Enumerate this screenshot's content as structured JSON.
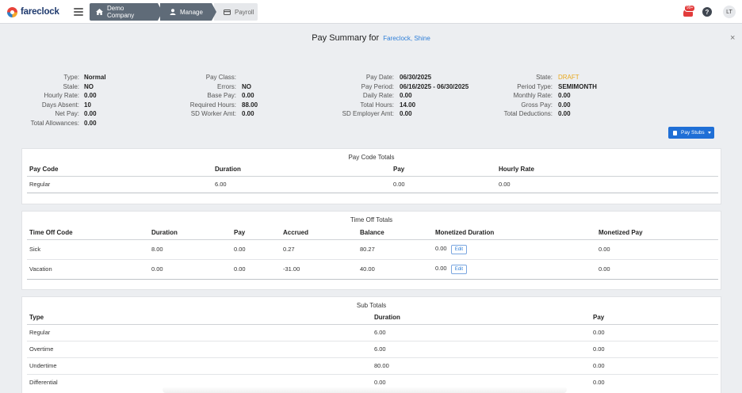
{
  "app": {
    "logo_text": "fareclock"
  },
  "breadcrumbs": [
    {
      "label": "Demo Company",
      "icon": "home-icon"
    },
    {
      "label": "Manage",
      "icon": "user-icon"
    },
    {
      "label": "Payroll",
      "icon": "card-icon"
    }
  ],
  "header_right": {
    "notification_badge": "99+",
    "help_label": "?",
    "avatar_initials": "LT"
  },
  "page": {
    "title": "Pay Summary for",
    "employee": "Fareclock, Shine",
    "close_label": "×"
  },
  "summary": {
    "col1": [
      {
        "label": "Type:",
        "value": "Normal"
      },
      {
        "label": "Stale:",
        "value": "NO"
      },
      {
        "label": "Hourly Rate:",
        "value": "0.00"
      },
      {
        "label": "Days Absent:",
        "value": "10"
      },
      {
        "label": "Net Pay:",
        "value": "0.00"
      },
      {
        "label": "Total Allowances:",
        "value": "0.00"
      }
    ],
    "col2": [
      {
        "label": "Pay Class:",
        "value": ""
      },
      {
        "label": "Errors:",
        "value": "NO"
      },
      {
        "label": "Base Pay:",
        "value": "0.00"
      },
      {
        "label": "Required Hours:",
        "value": "88.00"
      },
      {
        "label": "SD Worker Amt:",
        "value": "0.00"
      }
    ],
    "col3": [
      {
        "label": "Pay Date:",
        "value": "06/30/2025"
      },
      {
        "label": "Pay Period:",
        "value": "06/16/2025 - 06/30/2025"
      },
      {
        "label": "Daily Rate:",
        "value": "0.00"
      },
      {
        "label": "Total Hours:",
        "value": "14.00"
      },
      {
        "label": "SD Employer Amt:",
        "value": "0.00"
      }
    ],
    "col4": [
      {
        "label": "State:",
        "value": "DRAFT"
      },
      {
        "label": "Period Type:",
        "value": "SEMIMONTH"
      },
      {
        "label": "Monthly Rate:",
        "value": "0.00"
      },
      {
        "label": "Gross Pay:",
        "value": "0.00"
      },
      {
        "label": "Total Deductions:",
        "value": "0.00"
      }
    ],
    "state_color": "#e8a81e"
  },
  "paystubs_button": {
    "label": "Pay Stubs"
  },
  "pay_code_totals": {
    "title": "Pay Code Totals",
    "headers": [
      "Pay Code",
      "Duration",
      "Pay",
      "Hourly Rate"
    ],
    "rows": [
      [
        "Regular",
        "6.00",
        "0.00",
        "0.00"
      ]
    ]
  },
  "time_off_totals": {
    "title": "Time Off Totals",
    "headers": [
      "Time Off Code",
      "Duration",
      "Pay",
      "Accrued",
      "Balance",
      "Monetized Duration",
      "Monetized Pay"
    ],
    "rows": [
      [
        "Sick",
        "8.00",
        "0.00",
        "0.27",
        "80.27",
        "0.00",
        "0.00"
      ],
      [
        "Vacation",
        "0.00",
        "0.00",
        "-31.00",
        "40.00",
        "0.00",
        "0.00"
      ]
    ],
    "edit_label": "Edit"
  },
  "sub_totals": {
    "title": "Sub Totals",
    "headers": [
      "Type",
      "Duration",
      "Pay"
    ],
    "rows": [
      [
        "Regular",
        "6.00",
        "0.00"
      ],
      [
        "Overtime",
        "6.00",
        "0.00"
      ],
      [
        "Undertime",
        "80.00",
        "0.00"
      ],
      [
        "Differential",
        "0.00",
        "0.00"
      ]
    ]
  },
  "colors": {
    "accent": "#1f6fd6",
    "breadcrumb": "#5f6b78",
    "link": "#2f7fd8",
    "alert": "#e23b3b"
  }
}
